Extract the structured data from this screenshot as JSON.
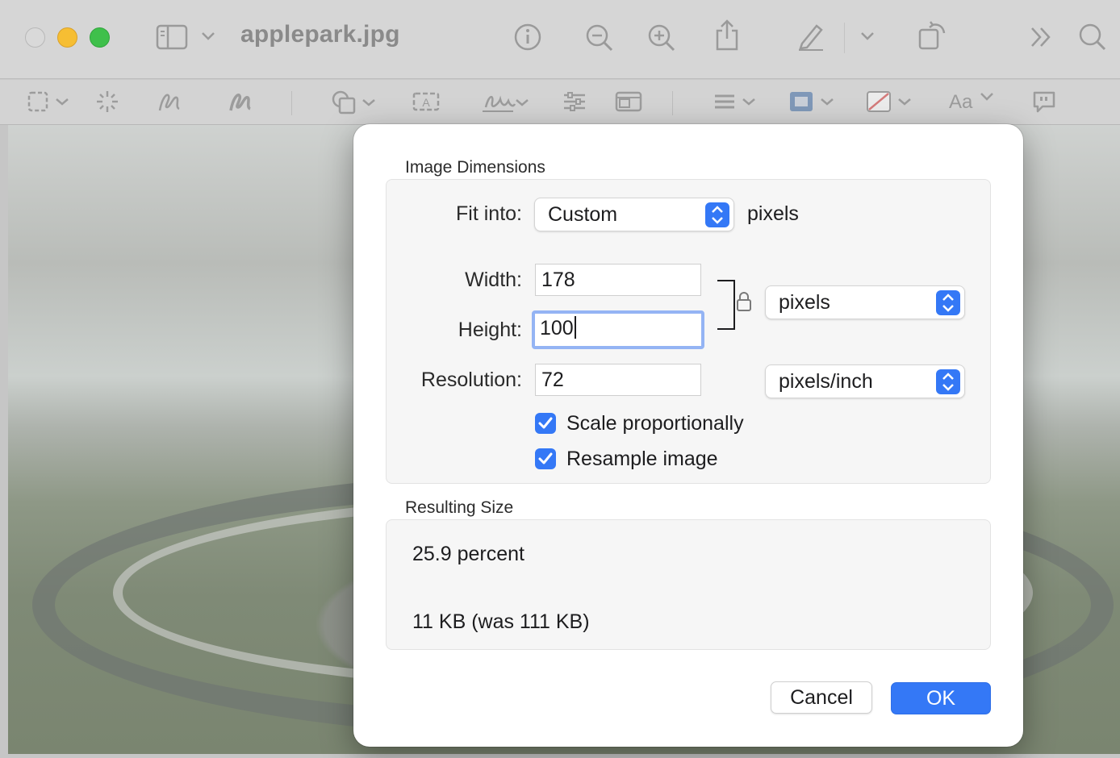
{
  "window": {
    "title": "applepark.jpg"
  },
  "toolbar_top": {
    "icons": [
      "sidebar-icon",
      "chevron-down-icon",
      "info-icon",
      "zoom-out-icon",
      "zoom-in-icon",
      "share-icon",
      "markup-pen-icon",
      "chevron-down-icon",
      "rotate-icon",
      "more-icon",
      "search-icon"
    ]
  },
  "markup_toolbar": {
    "icons": [
      "rect-selection-icon",
      "instant-alpha-icon",
      "sketch-icon",
      "draw-icon",
      "shapes-icon",
      "text-box-icon",
      "signature-icon",
      "adjust-color-icon",
      "adjust-size-icon",
      "line-style-icon",
      "border-color-icon",
      "fill-color-icon",
      "text-style-icon",
      "notes-icon"
    ],
    "text_style_label": "Aa"
  },
  "dialog": {
    "image_dimensions_label": "Image Dimensions",
    "fit_into": {
      "label": "Fit into:",
      "value": "Custom",
      "unit": "pixels"
    },
    "width": {
      "label": "Width:",
      "value": "178"
    },
    "height": {
      "label": "Height:",
      "value": "100"
    },
    "resolution": {
      "label": "Resolution:",
      "value": "72"
    },
    "size_unit": "pixels",
    "resolution_unit": "pixels/inch",
    "scale_proportionally": {
      "label": "Scale proportionally",
      "checked": true
    },
    "resample_image": {
      "label": "Resample image",
      "checked": true
    },
    "resulting_size_label": "Resulting Size",
    "result_percent": "25.9 percent",
    "result_filesize": "11 KB (was 111 KB)",
    "cancel_label": "Cancel",
    "ok_label": "OK"
  },
  "colors": {
    "accent": "#3478f6",
    "focus_ring": "#94b4f4"
  }
}
